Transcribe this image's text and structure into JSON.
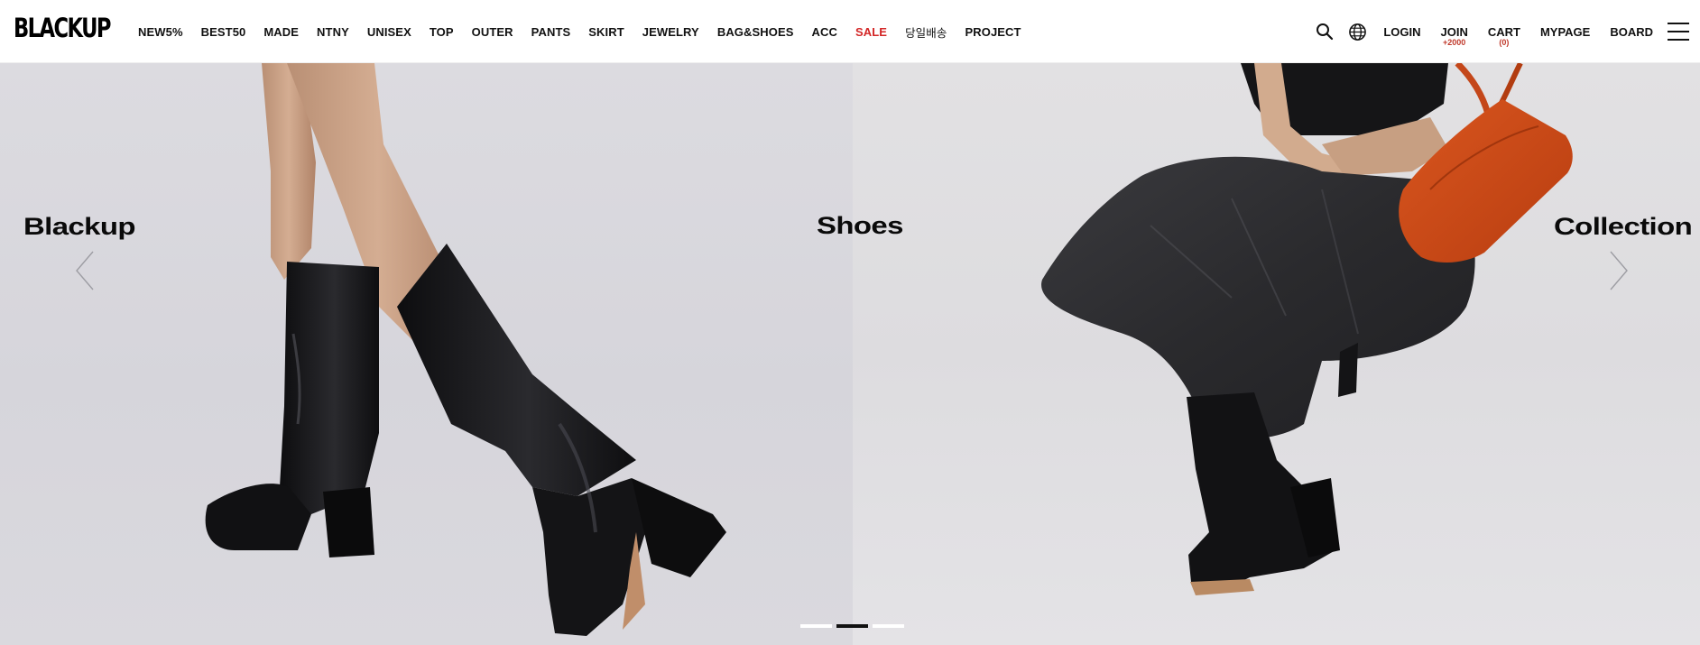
{
  "brand": {
    "logo": "BLACKUP"
  },
  "nav": {
    "items": [
      {
        "label": "NEW5%",
        "name": "nav-item-new5"
      },
      {
        "label": "BEST50",
        "name": "nav-item-best50"
      },
      {
        "label": "MADE",
        "name": "nav-item-made"
      },
      {
        "label": "NTNY",
        "name": "nav-item-ntny"
      },
      {
        "label": "UNISEX",
        "name": "nav-item-unisex"
      },
      {
        "label": "TOP",
        "name": "nav-item-top"
      },
      {
        "label": "OUTER",
        "name": "nav-item-outer"
      },
      {
        "label": "PANTS",
        "name": "nav-item-pants"
      },
      {
        "label": "SKIRT",
        "name": "nav-item-skirt"
      },
      {
        "label": "JEWELRY",
        "name": "nav-item-jewelry"
      },
      {
        "label": "BAG&SHOES",
        "name": "nav-item-bag-shoes"
      },
      {
        "label": "ACC",
        "name": "nav-item-acc"
      },
      {
        "label": "SALE",
        "name": "nav-item-sale"
      },
      {
        "label": "당일배송",
        "name": "nav-item-same-day-delivery"
      },
      {
        "label": "PROJECT",
        "name": "nav-item-project"
      }
    ]
  },
  "util": {
    "search_icon": "search-icon",
    "globe_icon": "globe-icon",
    "login": "LOGIN",
    "join": "JOIN",
    "join_badge": "+2000",
    "cart": "CART",
    "cart_count": "(0)",
    "mypage": "MYPAGE",
    "board": "BOARD",
    "menu_icon": "hamburger-menu-icon"
  },
  "colors": {
    "sale": "#d32626",
    "badge": "#c0392b",
    "text": "#111111",
    "pager_active": "#111111",
    "pager_inactive": "#ffffff"
  },
  "hero": {
    "words": [
      "Blackup",
      "Shoes",
      "Collection"
    ],
    "prev_icon": "chevron-left-icon",
    "next_icon": "chevron-right-icon",
    "slides_total": 3,
    "active_slide": 2
  }
}
